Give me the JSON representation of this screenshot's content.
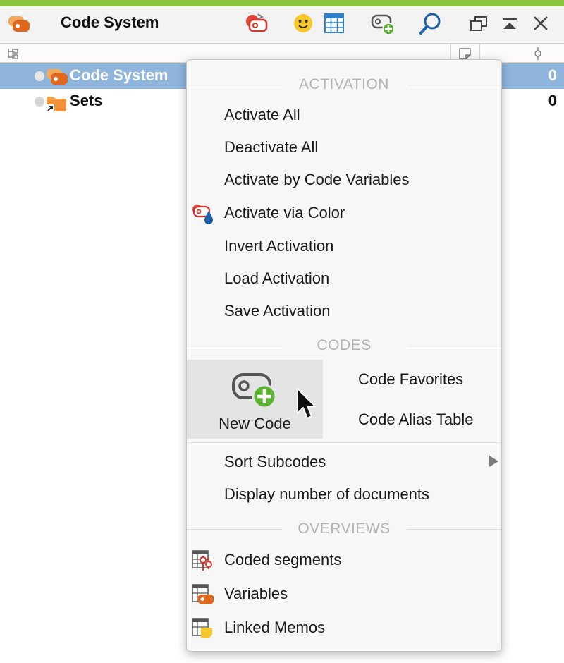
{
  "window": {
    "title": "Code System",
    "accent_color": "#8cc43f",
    "toolbar_icons": [
      "code-system-icon",
      "activation-icon",
      "smiley-icon",
      "table-icon",
      "new-code-icon",
      "search-icon",
      "undock-icon",
      "collapse-icon",
      "close-icon"
    ]
  },
  "tree": {
    "rows": [
      {
        "label": "Code System",
        "count": "0",
        "selected": true
      },
      {
        "label": "Sets",
        "count": "0",
        "selected": false
      }
    ]
  },
  "menu": {
    "activation": {
      "header": "ACTIVATION",
      "items": [
        "Activate All",
        "Deactivate All",
        "Activate by Code Variables",
        "Activate via Color",
        "Invert Activation",
        "Load Activation",
        "Save Activation"
      ]
    },
    "codes": {
      "header": "CODES",
      "new_code": "New Code",
      "favorites": "Code Favorites",
      "alias_table": "Code Alias Table"
    },
    "other": {
      "sort_subcodes": "Sort Subcodes",
      "display_docs": "Display number of documents"
    },
    "overviews": {
      "header": "OVERVIEWS",
      "items": [
        "Coded segments",
        "Variables",
        "Linked Memos"
      ]
    }
  }
}
